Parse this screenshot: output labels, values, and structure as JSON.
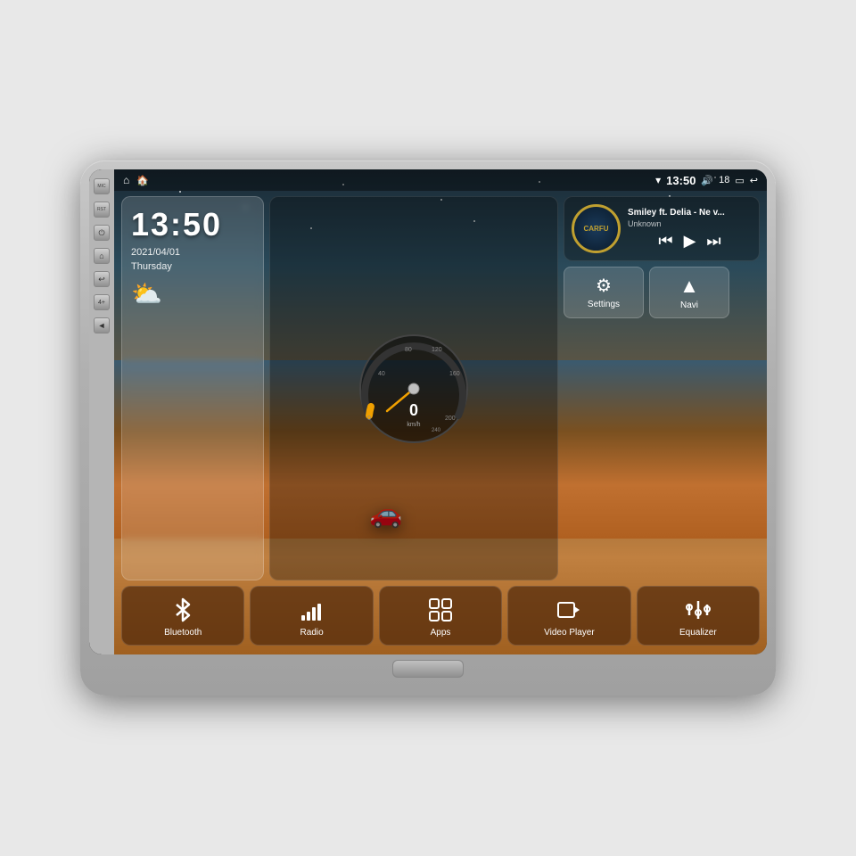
{
  "device": {
    "side_buttons": [
      {
        "label": "MIC",
        "icon": "🎤"
      },
      {
        "label": "RST",
        "icon": ""
      },
      {
        "label": "",
        "icon": "⏻"
      },
      {
        "label": "",
        "icon": "⌂"
      },
      {
        "label": "",
        "icon": "↩"
      },
      {
        "label": "",
        "icon": "4+"
      },
      {
        "label": "",
        "icon": "◄"
      }
    ]
  },
  "status_bar": {
    "home_icon": "⌂",
    "house_icon": "🏠",
    "wifi_icon": "▾",
    "time": "13:50",
    "volume_icon": "🔊",
    "volume_level": "18",
    "battery_icon": "▭",
    "back_icon": "↩"
  },
  "clock": {
    "time": "13:50",
    "date": "2021/04/01",
    "day": "Thursday"
  },
  "media": {
    "logo": "CARFU",
    "title": "Smiley ft. Delia - Ne v...",
    "artist": "Unknown",
    "prev_icon": "⏮",
    "play_icon": "▶",
    "next_icon": "⏭"
  },
  "quick_buttons": [
    {
      "label": "Settings",
      "icon": "⚙"
    },
    {
      "label": "Navi",
      "icon": "▲"
    }
  ],
  "app_buttons": [
    {
      "label": "Bluetooth",
      "icon": "bluetooth"
    },
    {
      "label": "Radio",
      "icon": "radio"
    },
    {
      "label": "Apps",
      "icon": "apps"
    },
    {
      "label": "Video Player",
      "icon": "video"
    },
    {
      "label": "Equalizer",
      "icon": "equalizer"
    }
  ],
  "colors": {
    "accent": "#c0a030",
    "bg_dark": "#1a2a35",
    "bg_warm": "#8a6030",
    "app_btn_bg": "rgba(80,40,10,0.7)"
  }
}
